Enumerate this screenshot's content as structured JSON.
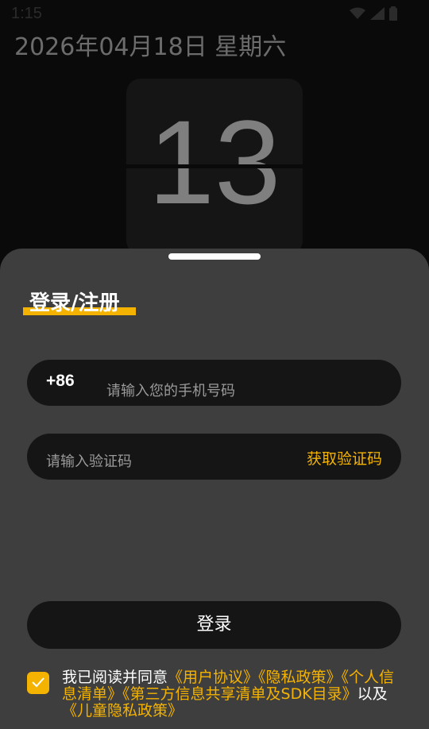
{
  "status_bar": {
    "time": "1:15",
    "icons": [
      "wifi-icon",
      "signal-icon",
      "battery-icon"
    ]
  },
  "header": {
    "date": "2026年04月18日 星期六"
  },
  "clock": {
    "value": "13"
  },
  "login": {
    "title": "登录/注册",
    "phone_prefix": "+86",
    "phone_placeholder": "请输入您的手机号码",
    "phone_value": "",
    "code_placeholder": "请输入验证码",
    "code_value": "",
    "get_code_label": "获取验证码",
    "submit_label": "登录"
  },
  "agreement": {
    "checked": true,
    "prefix": "我已阅读并同意",
    "link_user": "《用户协议》",
    "link_privacy": "《隐私政策》",
    "link_personal": "《个人信息清单》",
    "link_thirdparty": "《第三方信息共享清单及SDK目录》",
    "middle": "以及",
    "link_child": "《儿童隐私政策》"
  },
  "colors": {
    "accent": "#f5b301",
    "background": "#0a0a0a",
    "sheet": "#3e3e3e",
    "field": "#151515"
  }
}
